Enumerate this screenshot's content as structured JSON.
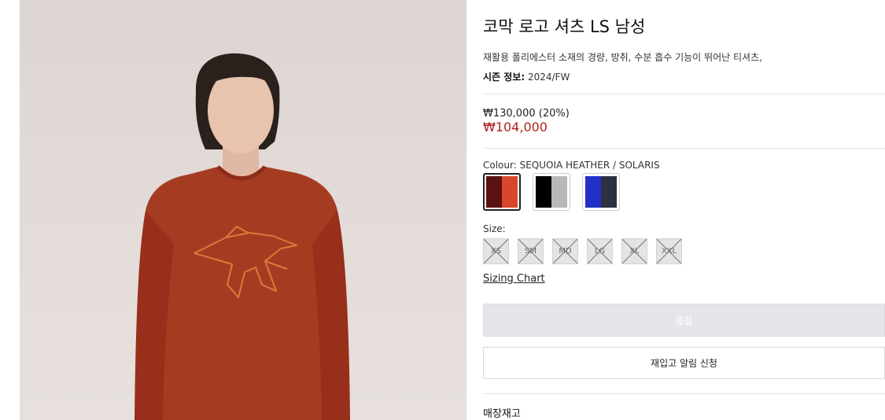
{
  "product": {
    "title": "코막 로고 셔츠 LS 남성",
    "description": "재활용 폴리에스터 소재의 경량, 방취, 수분 흡수 기능이 뛰어난 티셔츠,",
    "season_label": "시즌 정보:",
    "season_value": "2024/FW",
    "original_price": "₩130,000 (20%)",
    "sale_price": "₩104,000",
    "image_alt": "Model wearing red long-sleeve shirt with logo"
  },
  "colour": {
    "label": "Colour: SEQUOIA HEATHER / SOLARIS",
    "swatches": [
      {
        "name": "SEQUOIA HEATHER / SOLARIS",
        "left": "#5c1210",
        "right": "#d9472a",
        "selected": true
      },
      {
        "name": "BLACK / GREY",
        "left": "#000000",
        "right": "#b8b8b8",
        "selected": false
      },
      {
        "name": "BLUE / NAVY",
        "left": "#2230c8",
        "right": "#2c3142",
        "selected": false
      }
    ]
  },
  "size": {
    "label": "Size:",
    "options": [
      "XS",
      "SM",
      "MD",
      "LG",
      "XL",
      "XXL"
    ],
    "all_sold_out": true
  },
  "sizing_chart": "Sizing Chart",
  "buttons": {
    "sold_out": "품절",
    "restock_alert": "재입고 알림 신청"
  },
  "store_stock": "매장재고",
  "colors": {
    "sale": "#b32020",
    "disabled_button": "#e4e6ea"
  }
}
